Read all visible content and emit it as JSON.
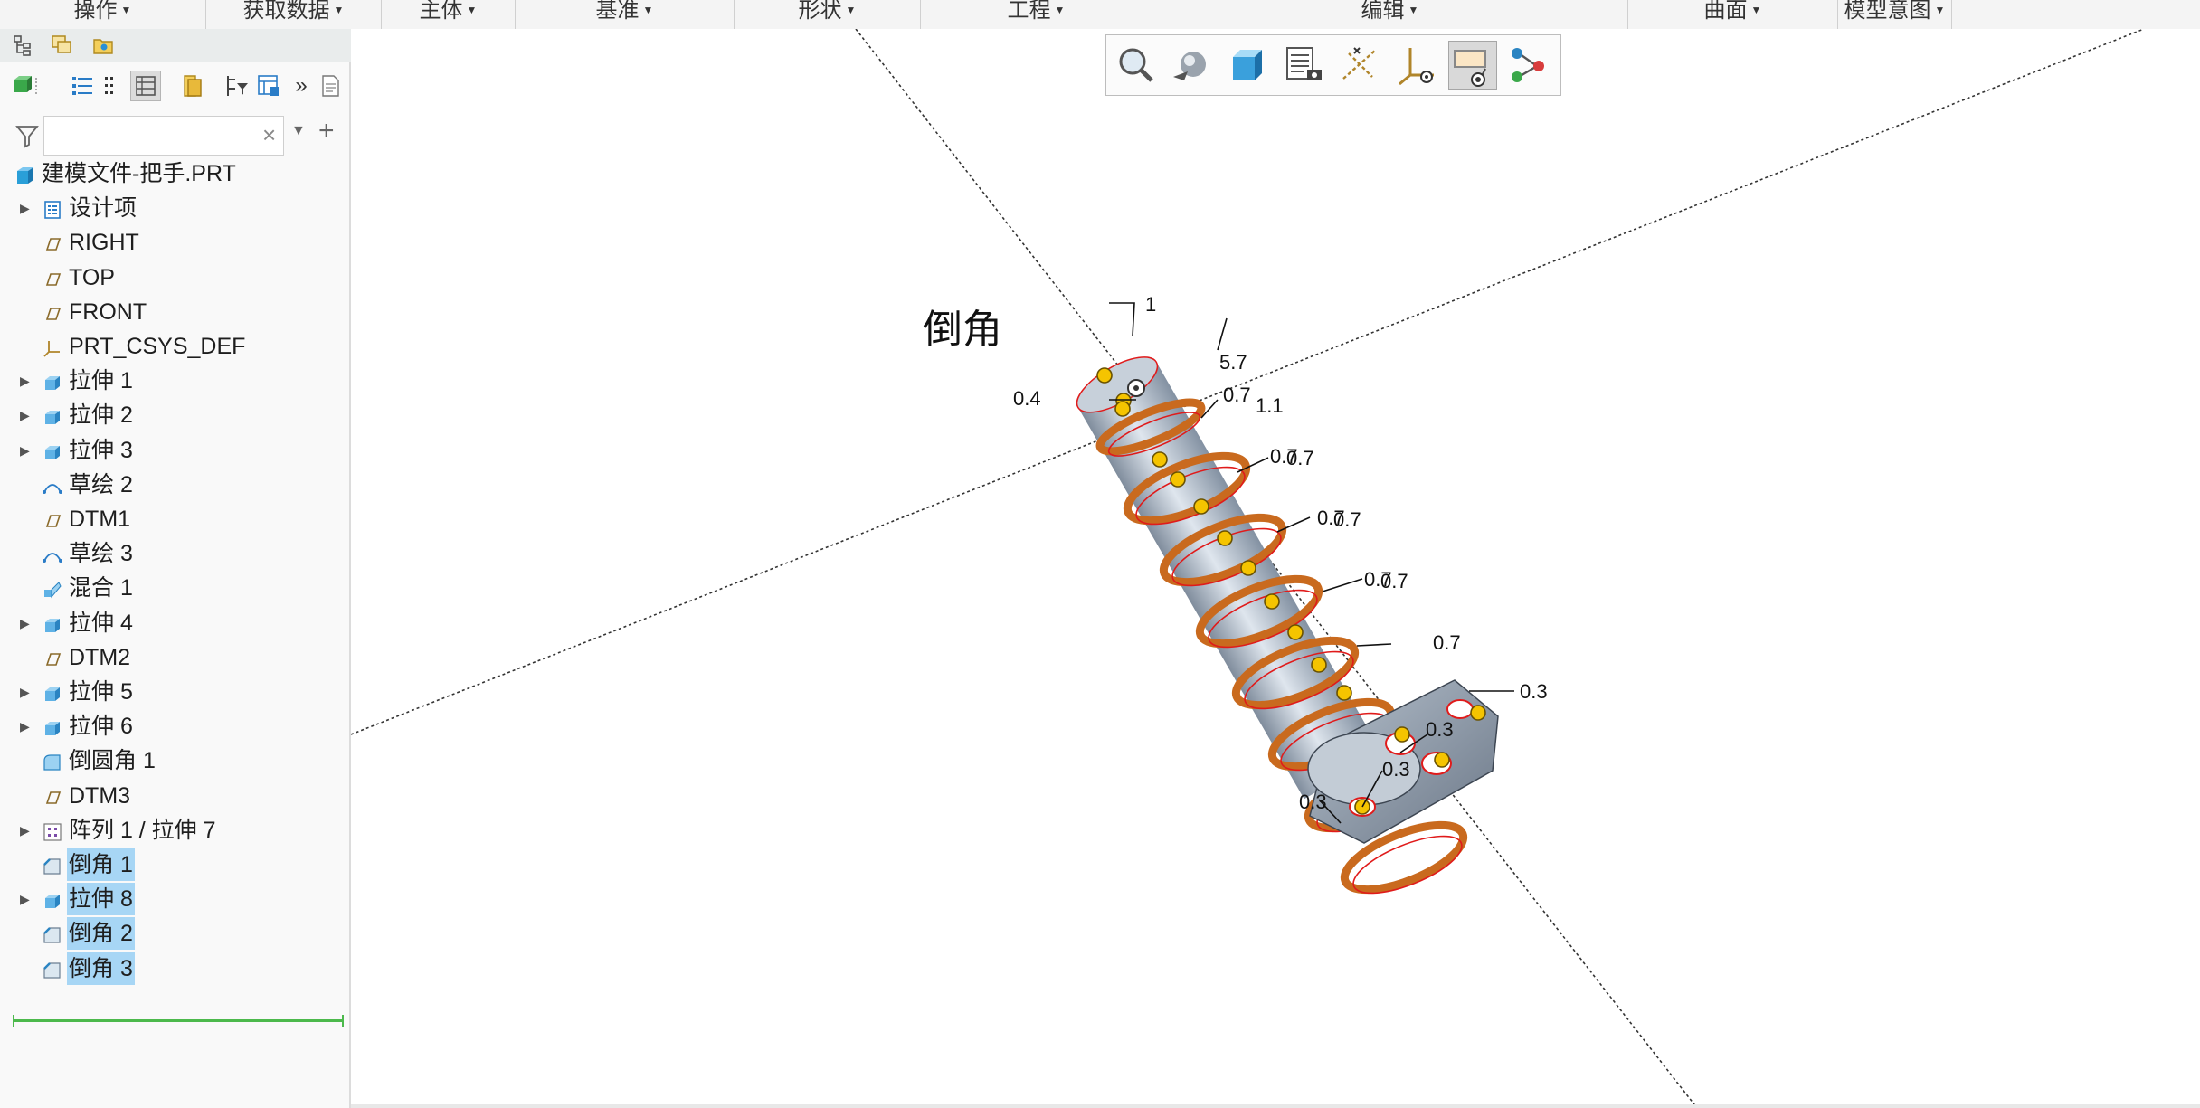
{
  "ribbon": {
    "groups": [
      {
        "label": "操作"
      },
      {
        "label": "获取数据"
      },
      {
        "label": "主体"
      },
      {
        "label": "基准"
      },
      {
        "label": "形状"
      },
      {
        "label": "工程"
      },
      {
        "label": "编辑"
      },
      {
        "label": "曲面"
      },
      {
        "label": "模型意图"
      }
    ]
  },
  "panel": {
    "tabs": [
      "model-tree-tab-icon",
      "layer-tree-tab-icon",
      "favorites-tab-icon"
    ],
    "tools": [
      "show-icon",
      "tree-list-icon",
      "tree-compact-icon",
      "tree-columns-icon",
      "folder-icon",
      "tree-filter-icon",
      "settings-table-icon",
      "more-icon",
      "document-icon"
    ],
    "filter": {
      "value": "",
      "clear_glyph": "×",
      "add_glyph": "+"
    }
  },
  "tree": {
    "root": {
      "label": "建模文件-把手.PRT",
      "icon": "part-icon"
    },
    "items": [
      {
        "label": "设计项",
        "icon": "design-items-icon",
        "expandable": true,
        "selected": false
      },
      {
        "label": "RIGHT",
        "icon": "datum-plane-icon",
        "expandable": false,
        "selected": false
      },
      {
        "label": "TOP",
        "icon": "datum-plane-icon",
        "expandable": false,
        "selected": false
      },
      {
        "label": "FRONT",
        "icon": "datum-plane-icon",
        "expandable": false,
        "selected": false
      },
      {
        "label": "PRT_CSYS_DEF",
        "icon": "coordinate-system-icon",
        "expandable": false,
        "selected": false
      },
      {
        "label": "拉伸 1",
        "icon": "extrude-icon",
        "expandable": true,
        "selected": false
      },
      {
        "label": "拉伸 2",
        "icon": "extrude-icon",
        "expandable": true,
        "selected": false
      },
      {
        "label": "拉伸 3",
        "icon": "extrude-icon",
        "expandable": true,
        "selected": false
      },
      {
        "label": "草绘 2",
        "icon": "sketch-icon",
        "expandable": false,
        "selected": false
      },
      {
        "label": "DTM1",
        "icon": "datum-plane-icon",
        "expandable": false,
        "selected": false
      },
      {
        "label": "草绘 3",
        "icon": "sketch-icon",
        "expandable": false,
        "selected": false
      },
      {
        "label": "混合 1",
        "icon": "blend-icon",
        "expandable": false,
        "selected": false
      },
      {
        "label": "拉伸 4",
        "icon": "extrude-icon",
        "expandable": true,
        "selected": false
      },
      {
        "label": "DTM2",
        "icon": "datum-plane-icon",
        "expandable": false,
        "selected": false
      },
      {
        "label": "拉伸 5",
        "icon": "extrude-icon",
        "expandable": true,
        "selected": false
      },
      {
        "label": "拉伸 6",
        "icon": "extrude-icon",
        "expandable": true,
        "selected": false
      },
      {
        "label": "倒圆角 1",
        "icon": "round-icon",
        "expandable": false,
        "selected": false
      },
      {
        "label": "DTM3",
        "icon": "datum-plane-icon",
        "expandable": false,
        "selected": false
      },
      {
        "label": "阵列 1 / 拉伸 7",
        "icon": "pattern-icon",
        "expandable": true,
        "selected": false
      },
      {
        "label": "倒角 1",
        "icon": "chamfer-icon",
        "expandable": false,
        "selected": true
      },
      {
        "label": "拉伸 8",
        "icon": "extrude-icon",
        "expandable": true,
        "selected": true
      },
      {
        "label": "倒角 2",
        "icon": "chamfer-icon",
        "expandable": false,
        "selected": true
      },
      {
        "label": "倒角 3",
        "icon": "chamfer-icon",
        "expandable": false,
        "selected": true
      }
    ]
  },
  "view_toolbar": {
    "buttons": [
      "zoom-icon",
      "display-style-icon",
      "saved-orientations-icon",
      "view-manager-icon",
      "datum-display-icon",
      "csys-display-icon",
      "annotation-display-icon",
      "spin-center-icon"
    ],
    "active_index": 6
  },
  "graphics": {
    "feature_title": "倒角",
    "dimensions": [
      "1",
      "5.7",
      "0.4",
      "0.7",
      "1.1",
      "0.7",
      "0.7",
      "0.7",
      "0.7",
      "0.7",
      "0.7",
      "0.7",
      "0.3",
      "0.3",
      "0.3",
      "0.3"
    ]
  },
  "colors": {
    "selection": "#a7d6f5",
    "insert_indicator": "#4cb94c",
    "edge_highlight": "#e01b1b",
    "handle": "#f5c400",
    "chamfer_surface": "#c96a1e"
  }
}
